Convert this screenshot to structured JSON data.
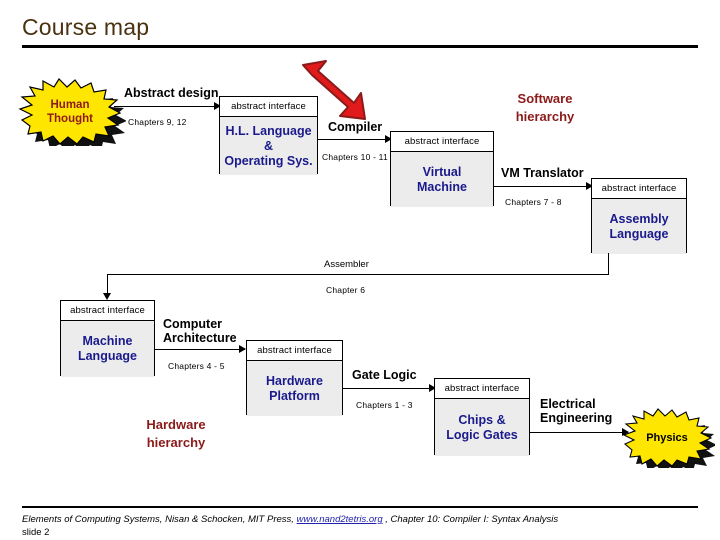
{
  "page_title": "Course map",
  "hierarchy_labels": {
    "software": "Software\nhierarchy",
    "software_line1": "Software",
    "software_line2": "hierarchy",
    "hardware_line1": "Hardware",
    "hardware_line2": "hierarchy"
  },
  "interface_header": "abstract interface",
  "bursts": [
    {
      "name": "human-thought",
      "line1": "Human",
      "line2": "Thought",
      "fill": "#ffe600",
      "text_color": "#8c1a1a"
    },
    {
      "name": "physics",
      "line1": "Physics",
      "line2": "",
      "fill": "#ffe600",
      "text_color": "#000000"
    }
  ],
  "boxes": [
    {
      "id": "hl-language",
      "header": "abstract interface",
      "line1": "H.L. Language",
      "line2": "&",
      "line3": "Operating Sys."
    },
    {
      "id": "virtual-machine",
      "header": "abstract interface",
      "line1": "Virtual",
      "line2": "Machine",
      "line3": ""
    },
    {
      "id": "assembly-language",
      "header": "abstract interface",
      "line1": "Assembly",
      "line2": "Language",
      "line3": ""
    },
    {
      "id": "machine-language",
      "header": "abstract interface",
      "line1": "Machine",
      "line2": "Language",
      "line3": ""
    },
    {
      "id": "hardware-platform",
      "header": "abstract interface",
      "line1": "Hardware",
      "line2": "Platform",
      "line3": ""
    },
    {
      "id": "chips-logic-gates",
      "header": "abstract interface",
      "line1": "Chips &",
      "line2": "Logic Gates",
      "line3": ""
    }
  ],
  "edges": [
    {
      "id": "abstract-design",
      "label": "Abstract design",
      "chapters": "Chapters 9, 12"
    },
    {
      "id": "compiler",
      "label": "Compiler",
      "chapters": "Chapters 10 - 11"
    },
    {
      "id": "vm-translator",
      "label": "VM Translator",
      "chapters": "Chapters 7 - 8"
    },
    {
      "id": "assembler",
      "label": "Assembler",
      "chapters": "Chapter 6"
    },
    {
      "id": "computer-architecture",
      "label": "Computer\nArchitecture",
      "label_line1": "Computer",
      "label_line2": "Architecture",
      "chapters": "Chapters  4 - 5"
    },
    {
      "id": "gate-logic",
      "label": "Gate Logic",
      "chapters": "Chapters  1 - 3"
    },
    {
      "id": "electrical-engineering",
      "label": "Electrical\nEngineering",
      "label_line1": "Electrical",
      "label_line2": "Engineering",
      "chapters": ""
    }
  ],
  "footer": {
    "text_before": "Elements of Computing Systems, Nisan & Schocken, MIT Press, ",
    "link": "www.nand2tetris.org",
    "text_after": " , Chapter 10: Compiler I: Syntax Analysis",
    "slide": "slide 2"
  },
  "colors": {
    "title": "#4a3211",
    "box_body": "#ececec",
    "box_text": "#1a1a8c",
    "hierarchy_caption": "#8c1a1a",
    "burst_fill": "#ffe600",
    "red_arrow": "#e11b1b",
    "red_arrow_outline": "#8c1a1a",
    "link": "#2222aa"
  }
}
